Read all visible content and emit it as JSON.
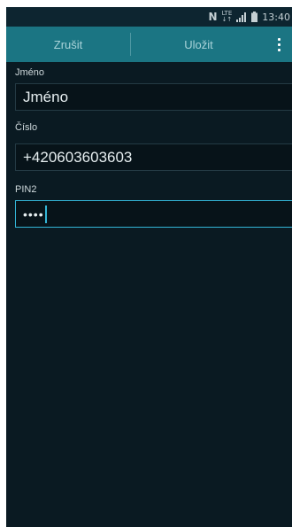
{
  "status_bar": {
    "nfc_icon": "N",
    "lte_label_top": "LTE",
    "lte_label_bottom": "↓↑",
    "time": "13:40"
  },
  "action_bar": {
    "cancel_label": "Zrušit",
    "save_label": "Uložit",
    "menu_icon": "overflow-menu-icon"
  },
  "form": {
    "name": {
      "label": "Jméno",
      "value": "Jméno"
    },
    "number": {
      "label": "Číslo",
      "value": "+420603603603"
    },
    "pin2": {
      "label": "PIN2",
      "value": "••••"
    }
  },
  "colors": {
    "action_bar": "#1b7583",
    "background": "#0a1a22",
    "accent": "#33b5d6"
  }
}
